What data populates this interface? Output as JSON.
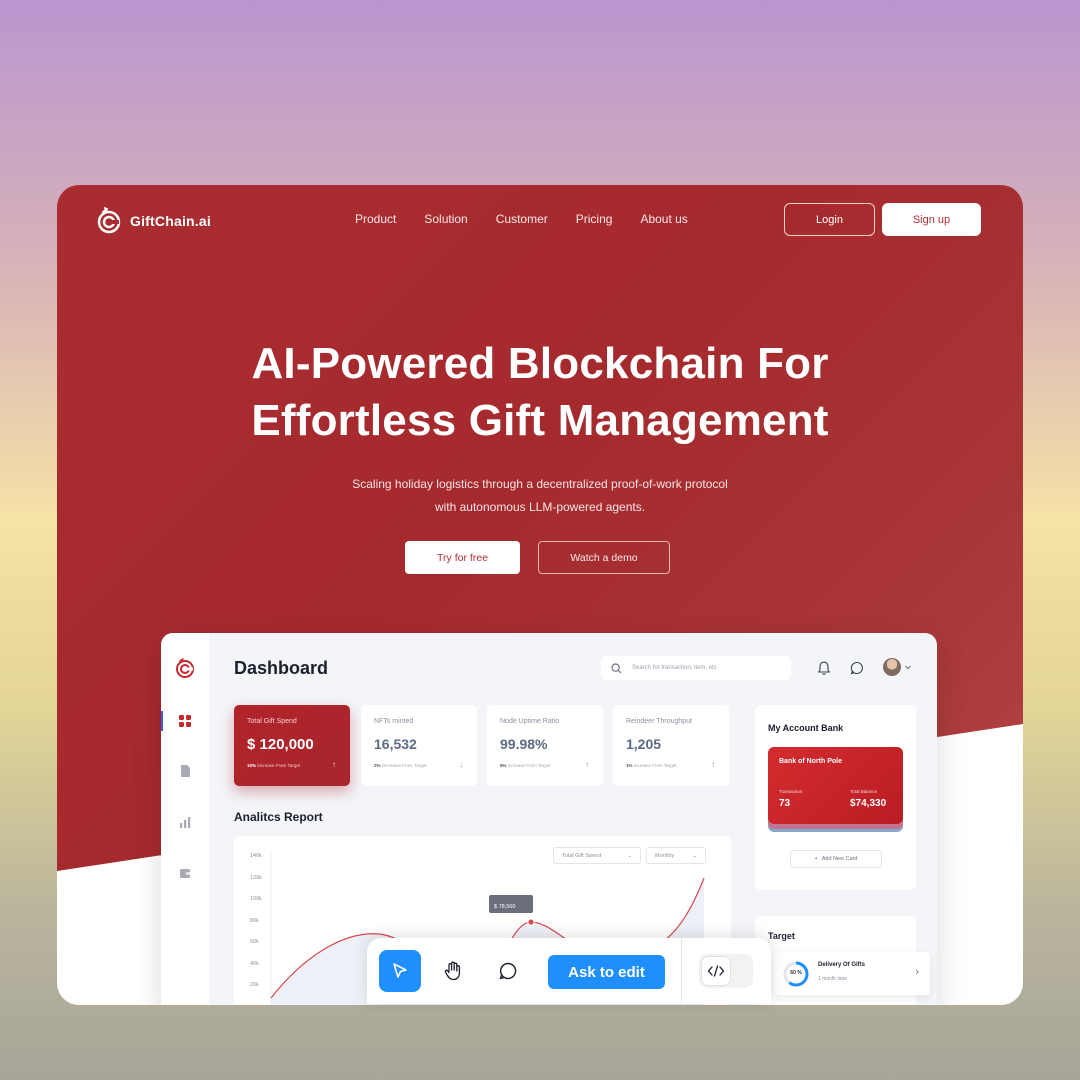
{
  "brand": {
    "name": "GiftChain.ai"
  },
  "nav": {
    "links": [
      "Product",
      "Solution",
      "Customer",
      "Pricing",
      "About us"
    ],
    "login_label": "Login",
    "signup_label": "Sign up"
  },
  "hero": {
    "headline_line1": "AI-Powered Blockchain For",
    "headline_line2": "Effortless Gift Management",
    "sub_line1": "Scaling holiday logistics through a decentralized proof-of-work protocol",
    "sub_line2": "with autonomous LLM-powered agents.",
    "cta_primary": "Try for free",
    "cta_secondary": "Watch a demo"
  },
  "dashboard": {
    "title": "Dashboard",
    "search_placeholder": "Search for transaction, item, etc",
    "stats": [
      {
        "label": "Total Gift Spend",
        "value": "$ 120,000",
        "note_pct": "10%",
        "note_text": "Increase From Target",
        "trend": "↑"
      },
      {
        "label": "NFTs minted",
        "value": "16,532",
        "note_pct": "2%",
        "note_text": "Decrease From Target",
        "trend": "↓"
      },
      {
        "label": "Node Uptime Ratio",
        "value": "99.98%",
        "note_pct": "6%",
        "note_text": "Increase From Target",
        "trend": "↑"
      },
      {
        "label": "Reindeer Throughput",
        "value": "1,205",
        "note_pct": "1%",
        "note_text": "Increase From Target",
        "trend": "↑"
      }
    ],
    "analytics": {
      "title": "Analitcs Report",
      "metric_select": "Total Gift Spend",
      "period_select": "Monthly",
      "tooltip_value": "$ 78,560"
    },
    "bank": {
      "title": "My Account Bank",
      "card_name": "Bank of North Pole",
      "transaction_label": "Transaction",
      "transaction_value": "73",
      "balance_label": "Total Balance",
      "balance_value": "$74,330",
      "add_card_label": "Add New Card"
    },
    "target": {
      "title": "Target",
      "item_title": "Delivery Of Gifts",
      "item_sub": "1 month later",
      "item_progress": "60 %"
    }
  },
  "chart_data": {
    "type": "line",
    "title": "Analitcs Report",
    "y_ticks": [
      "140k",
      "120k",
      "100k",
      "80k",
      "60k",
      "40k",
      "20k"
    ],
    "ylim": [
      0,
      140000
    ],
    "highlight": {
      "label": "$ 78,560",
      "value": 78560
    }
  },
  "toolbar": {
    "ask_label": "Ask to edit"
  },
  "colors": {
    "brand_red": "#a92c30",
    "accent_blue": "#1f8fff"
  }
}
